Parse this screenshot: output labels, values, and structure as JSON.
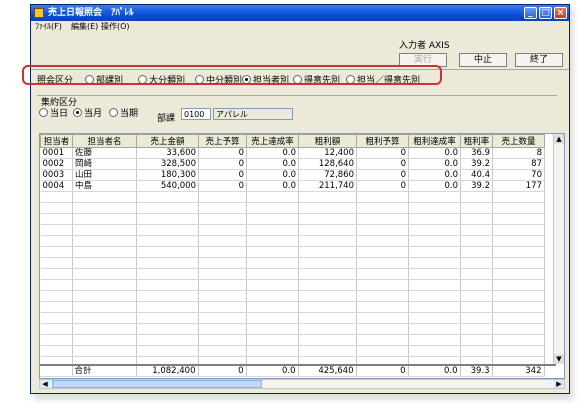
{
  "window": {
    "title": "売上日報照会",
    "subtitle": "ｱﾊﾟﾚﾙ"
  },
  "menu": [
    "ﾌｧｲﾙ(F)",
    "編集(E)",
    "操作(O)"
  ],
  "header": {
    "user_label": "入力者 AXIS",
    "exec_label": "実行",
    "stop_label": "中止",
    "end_label": "終了"
  },
  "mode": {
    "label": "照会区分",
    "options": [
      "部課別",
      "大分類別",
      "中分類別",
      "担当者別",
      "得意先別",
      "担当／得意先別"
    ],
    "selected": "担当者別"
  },
  "period": {
    "caption": "集約区分",
    "options": [
      "当日",
      "当月",
      "当期"
    ],
    "selected": "当月",
    "dept_label": "部課",
    "dept_code": "0100",
    "dept_name": "アパレル"
  },
  "table": {
    "columns": [
      "担当者",
      "担当者名",
      "売上金額",
      "売上予算",
      "売上達成率",
      "粗利額",
      "粗利予算",
      "粗利達成率",
      "粗利率",
      "売上数量"
    ],
    "rows": [
      [
        "0001",
        "佐藤",
        "33,600",
        "0",
        "0.0",
        "12,400",
        "0",
        "0.0",
        "36.9",
        "8"
      ],
      [
        "0002",
        "岡崎",
        "328,500",
        "0",
        "0.0",
        "128,640",
        "0",
        "0.0",
        "39.2",
        "87"
      ],
      [
        "0003",
        "山田",
        "180,300",
        "0",
        "0.0",
        "72,860",
        "0",
        "0.0",
        "40.4",
        "70"
      ],
      [
        "0004",
        "中島",
        "540,000",
        "0",
        "0.0",
        "211,740",
        "0",
        "0.0",
        "39.2",
        "177"
      ]
    ],
    "total": [
      "",
      "合計",
      "1,082,400",
      "0",
      "0.0",
      "425,640",
      "0",
      "0.0",
      "39.3",
      "342"
    ]
  }
}
